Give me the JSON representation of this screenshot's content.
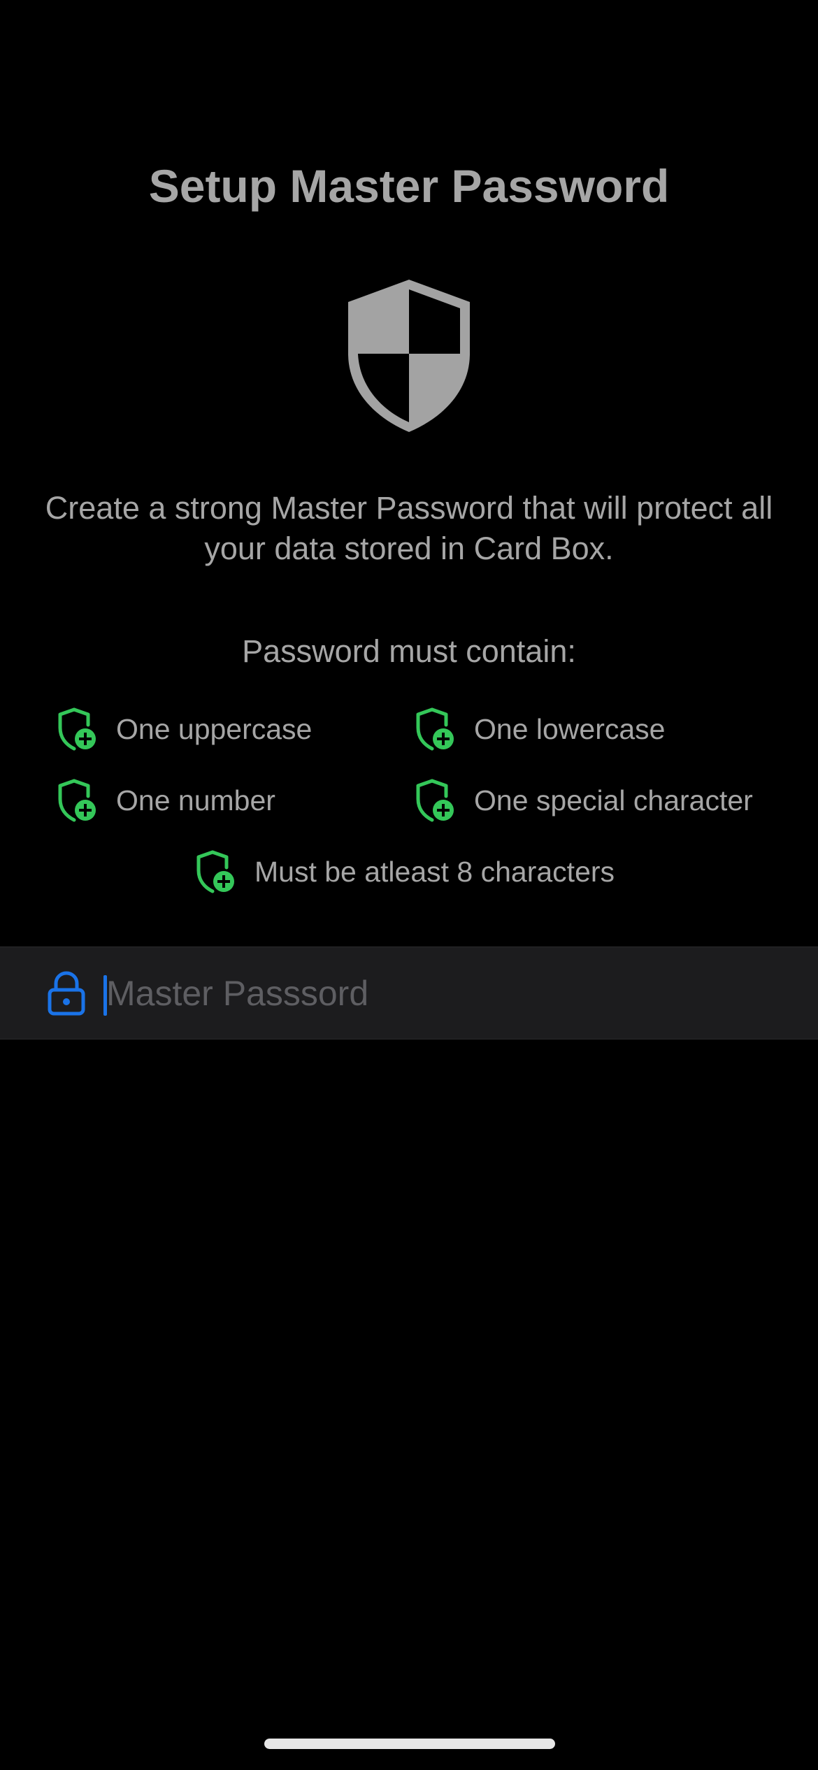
{
  "screen": {
    "title": "Setup Master Password",
    "description": "Create a strong Master Password that will protect all your data stored in Card Box."
  },
  "requirements": {
    "heading": "Password must contain:",
    "items": [
      {
        "label": "One uppercase",
        "icon": "shield-plus-icon"
      },
      {
        "label": "One lowercase",
        "icon": "shield-plus-icon"
      },
      {
        "label": "One number",
        "icon": "shield-plus-icon"
      },
      {
        "label": "One special character",
        "icon": "shield-plus-icon"
      },
      {
        "label": "Must be atleast 8 characters",
        "icon": "shield-plus-icon"
      }
    ]
  },
  "password_field": {
    "placeholder": "Master Passsord",
    "value": "",
    "icon": "lock-icon"
  },
  "colors": {
    "background": "#000000",
    "text": "#a6a6a6",
    "accent_green": "#34c759",
    "accent_blue": "#1a73e8",
    "field_background": "#1c1c1e"
  }
}
